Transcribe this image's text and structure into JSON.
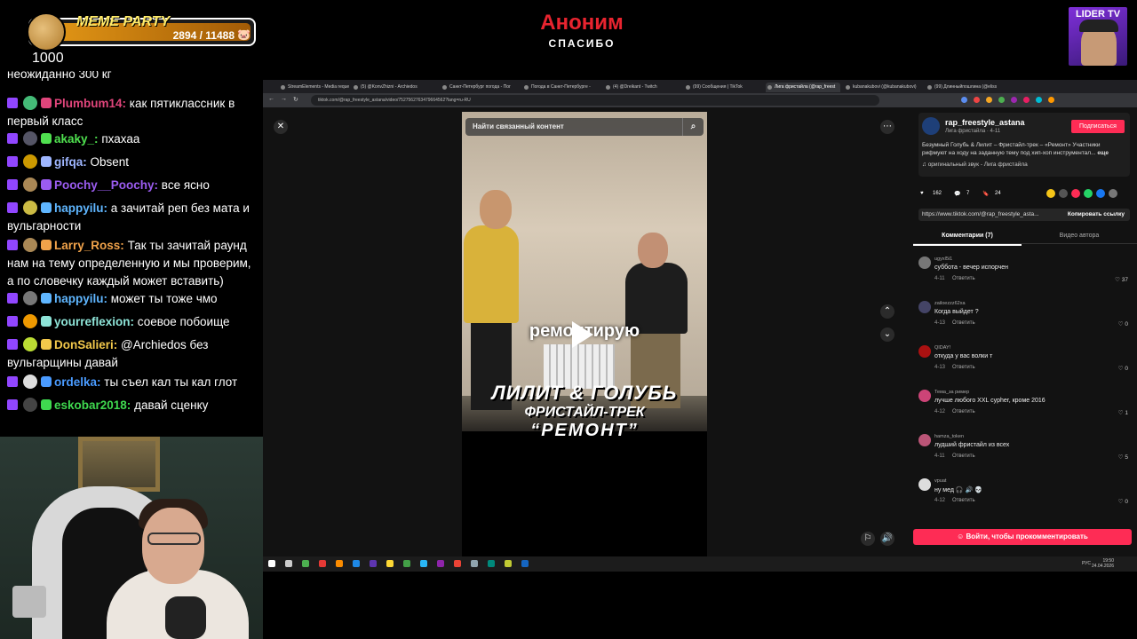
{
  "overlay": {
    "meme_title": "MEME PARTY",
    "meme_count": "2894 / 11488",
    "goal_value": "1000",
    "meme_fill_fraction": 0.25,
    "donor_name": "Аноним",
    "thanks": "СПАСИБО",
    "channel_badge": "LIDER TV"
  },
  "chat": {
    "messages": [
      {
        "user": "",
        "text": "неожиданно 300 кг",
        "color": "#ffffff"
      },
      {
        "user": "Plumbum14:",
        "text": "как пятиклассник в первый класс",
        "color": "#e0457b"
      },
      {
        "user": "akaky_:",
        "text": "пхахаа",
        "color": "#4fe04f"
      },
      {
        "user": "gifqa:",
        "text": "Obsent",
        "color": "#9fb6ff"
      },
      {
        "user": "Poochy__Poochy:",
        "text": "все ясно",
        "color": "#9b5cf0"
      },
      {
        "user": "happyilu:",
        "text": "а зачитай реп без мата и вульгарности",
        "color": "#5fb6ff"
      },
      {
        "user": "Larry_Ross:",
        "text": "Так ты зачитай раунд нам на тему определенную и мы проверим, а по словечку каждый может вставить)",
        "color": "#f0a24a"
      },
      {
        "user": "happyilu:",
        "text": "может ты тоже чмо",
        "color": "#5fb6ff"
      },
      {
        "user": "yourreflexion:",
        "text": "соевое побоище",
        "color": "#8ee4d8"
      },
      {
        "user": "DonSalieri:",
        "text": "@Archiedos без вульгарщины давай",
        "color": "#f2c84b"
      },
      {
        "user": "ordelka:",
        "text": "ты съел кал ты кал глот",
        "color": "#4a9bff"
      },
      {
        "user": "eskobar2018:",
        "text": "давай сценку",
        "color": "#3fd94f"
      }
    ]
  },
  "browser": {
    "tabs": [
      "StreamElements - Media reque",
      "(5) @KonvZhizni - Archiedos",
      "Санкт-Петербург погода - Пог",
      "Погода в Санкт-Петербурге -",
      "(4) @Dreikant - Twitch",
      "(99) Сообщения | TikTok",
      "Лига фристайла (@rap_freest",
      "kubanakubovi (@kubanakubovi)",
      "(99) Длинныйпошлина (@eliss"
    ],
    "active_tab": 6,
    "url": "tiktok.com/@rap_freestyle_astana/video/7527562763479664562?lang=ru-RU"
  },
  "video": {
    "search_placeholder": "Найти связанный контент",
    "caption": "ремонтирую",
    "title_line1": "ЛИЛИТ & ГОЛУБЬ",
    "title_line2": "ФРИСТАЙЛ-ТРЕК",
    "title_line3": "“РЕМОНТ”"
  },
  "panel": {
    "author": "rap_freestyle_astana",
    "author_sub": "Лига фристайла · 4-11",
    "follow": "Подписаться",
    "description": "Безумный Голубь & Лилит – Фристайл-трек – «Ремонт» Участники рифмуют на ходу на заданную тему под хип-хоп инструментал...",
    "more": "еще",
    "sound": "оригинальный звук - Лига фристайла",
    "likes": "162",
    "comments_count": "7",
    "saves": "24",
    "link": "https://www.tiktok.com/@rap_freestyle_asta...",
    "copy_link": "Копировать ссылку",
    "tab_comments": "Комментарии (7)",
    "tab_author_videos": "Видео автора",
    "login": "Войти, чтобы прокомментировать",
    "reply": "Ответить",
    "comments": [
      {
        "user": "ugyxl5i1",
        "text": "суббота - вечер испорчен",
        "date": "4-11",
        "likes": "37"
      },
      {
        "user": "zailoezzz62xa",
        "text": "Когда выйдет ?",
        "date": "4-13",
        "likes": "0"
      },
      {
        "user": "QIDAY!",
        "text": "откуда у вас волки т",
        "date": "4-13",
        "likes": "0"
      },
      {
        "user": "Тема_за ример",
        "text": "лучше любого XXL cypher, кроме 2016",
        "date": "4-12",
        "likes": "1"
      },
      {
        "user": "hamza_token",
        "text": "лудший фристайл из всех",
        "date": "4-11",
        "likes": "5"
      },
      {
        "user": "vpuat",
        "text": "ну мед 🎧 🔊 💀",
        "date": "4-12",
        "likes": "0"
      }
    ]
  },
  "taskbar": {
    "lang": "РУС",
    "time": "19:50",
    "date": "24.04.2026"
  }
}
